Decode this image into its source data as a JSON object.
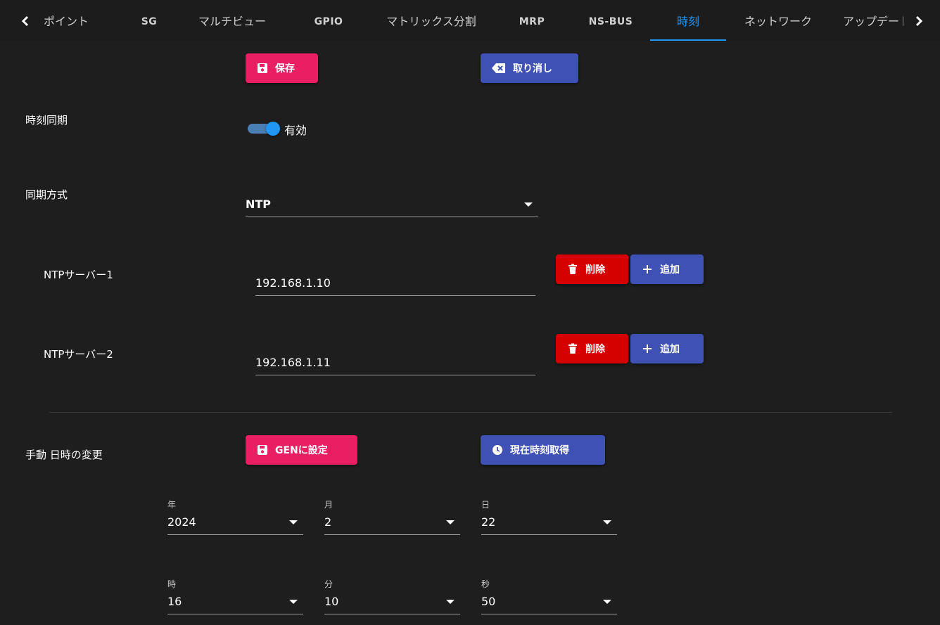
{
  "tabs": [
    {
      "label": "ポイント"
    },
    {
      "label": "SG"
    },
    {
      "label": "マルチビュー"
    },
    {
      "label": "GPIO"
    },
    {
      "label": "マトリックス分割"
    },
    {
      "label": "MRP"
    },
    {
      "label": "NS-BUS"
    },
    {
      "label": "時刻",
      "active": true
    },
    {
      "label": "ネットワーク"
    },
    {
      "label": "アップデート"
    }
  ],
  "toolbar": {
    "save_label": "保存",
    "cancel_label": "取り消し"
  },
  "time_sync": {
    "label": "時刻同期",
    "state_label": "有効",
    "enabled": true
  },
  "sync_method": {
    "label": "同期方式",
    "value": "NTP"
  },
  "ntp_servers": [
    {
      "label": "NTPサーバー1",
      "value": "192.168.1.10",
      "delete_label": "削除",
      "add_label": "追加"
    },
    {
      "label": "NTPサーバー2",
      "value": "192.168.1.11",
      "delete_label": "削除",
      "add_label": "追加"
    }
  ],
  "manual": {
    "label": "手動 日時の変更",
    "set_gen_label": "GENに設定",
    "get_time_label": "現在時刻取得",
    "year": {
      "label": "年",
      "value": "2024"
    },
    "month": {
      "label": "月",
      "value": "2"
    },
    "day": {
      "label": "日",
      "value": "22"
    },
    "hour": {
      "label": "時",
      "value": "16"
    },
    "minute": {
      "label": "分",
      "value": "10"
    },
    "second": {
      "label": "秒",
      "value": "50"
    }
  },
  "colors": {
    "accent": "#2196f3",
    "primary_pink": "#e91e63",
    "indigo": "#3f51b5",
    "danger": "#d50000"
  }
}
